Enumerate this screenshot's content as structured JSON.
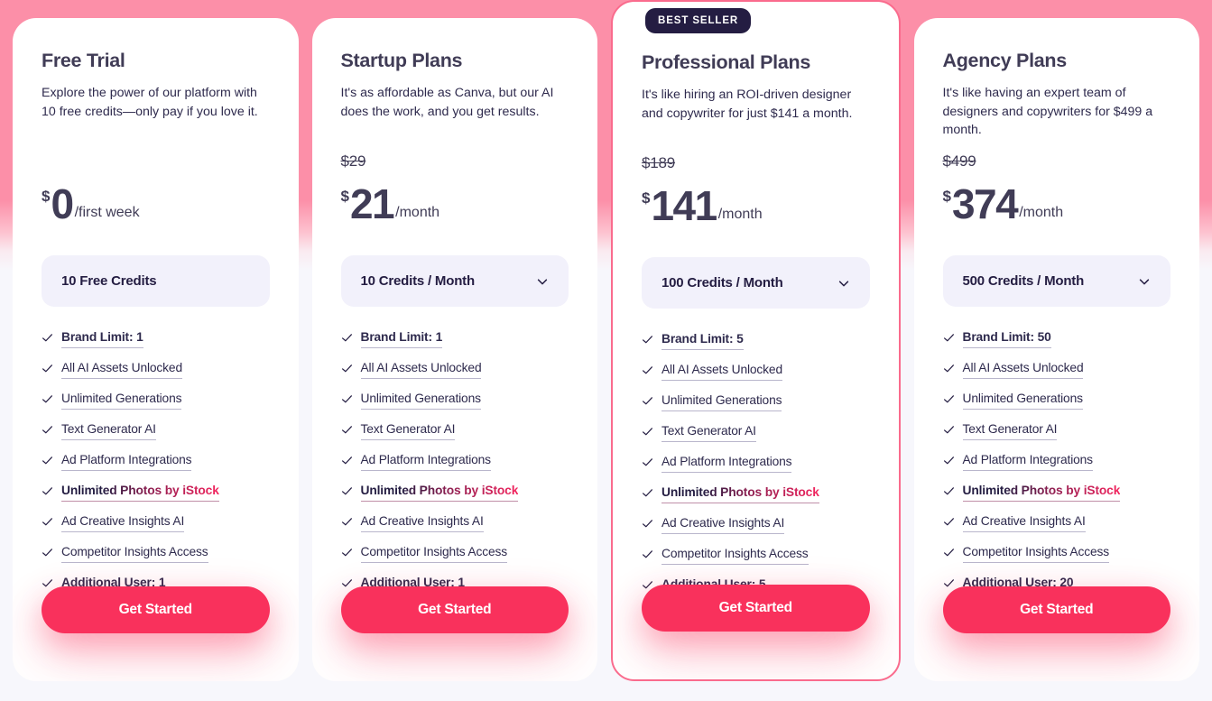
{
  "page": {
    "background_top_color": "#fc8fa8",
    "background_bottom_color": "#f7f7fc",
    "accent_color": "#f9315c",
    "badge_color": "#241d42"
  },
  "badge": {
    "label": "BEST SELLER"
  },
  "icons": {
    "check": "check-icon",
    "chevron": "chevron-down-icon"
  },
  "plans": [
    {
      "id": "free-trial",
      "title": "Free Trial",
      "description": "Explore the power of our platform with 10 free credits—only pay if you love it.",
      "old_price": "",
      "currency": "$",
      "amount": "0",
      "period": "/first week",
      "credits_label": "10 Free Credits",
      "has_dropdown": false,
      "featured": false,
      "cta_label": "Get Started",
      "features": [
        {
          "text": "Brand Limit: 1",
          "style": "bold"
        },
        {
          "text": "All AI Assets Unlocked",
          "style": "normal"
        },
        {
          "text": "Unlimited Generations",
          "style": "normal"
        },
        {
          "text": "Text Generator AI",
          "style": "normal"
        },
        {
          "text": "Ad Platform Integrations",
          "style": "normal"
        },
        {
          "text": "Unlimited Photos by iStock",
          "style": "gradient"
        },
        {
          "text": "Ad Creative Insights AI",
          "style": "normal"
        },
        {
          "text": "Competitor Insights Access",
          "style": "normal"
        },
        {
          "text": "Additional User: 1",
          "style": "bold"
        }
      ]
    },
    {
      "id": "startup-plans",
      "title": "Startup Plans",
      "description": "It's as affordable as Canva, but our AI does the work, and you get results.",
      "old_price": "$29",
      "currency": "$",
      "amount": "21",
      "period": "/month",
      "credits_label": "10 Credits / Month",
      "has_dropdown": true,
      "featured": false,
      "cta_label": "Get Started",
      "features": [
        {
          "text": "Brand Limit: 1",
          "style": "bold"
        },
        {
          "text": "All AI Assets Unlocked",
          "style": "normal"
        },
        {
          "text": "Unlimited Generations",
          "style": "normal"
        },
        {
          "text": "Text Generator AI",
          "style": "normal"
        },
        {
          "text": "Ad Platform Integrations",
          "style": "normal"
        },
        {
          "text": "Unlimited Photos by iStock",
          "style": "gradient"
        },
        {
          "text": "Ad Creative Insights AI",
          "style": "normal"
        },
        {
          "text": "Competitor Insights Access",
          "style": "normal"
        },
        {
          "text": "Additional User: 1",
          "style": "bold"
        }
      ]
    },
    {
      "id": "professional-plans",
      "title": "Professional Plans",
      "description": "It's like hiring an ROI-driven designer and copywriter for just $141 a month.",
      "old_price": "$189",
      "currency": "$",
      "amount": "141",
      "period": "/month",
      "credits_label": "100 Credits / Month",
      "has_dropdown": true,
      "featured": true,
      "cta_label": "Get Started",
      "features": [
        {
          "text": "Brand Limit: 5",
          "style": "bold"
        },
        {
          "text": "All AI Assets Unlocked",
          "style": "normal"
        },
        {
          "text": "Unlimited Generations",
          "style": "normal"
        },
        {
          "text": "Text Generator AI",
          "style": "normal"
        },
        {
          "text": "Ad Platform Integrations",
          "style": "normal"
        },
        {
          "text": "Unlimited Photos by iStock",
          "style": "gradient"
        },
        {
          "text": "Ad Creative Insights AI",
          "style": "normal"
        },
        {
          "text": "Competitor Insights Access",
          "style": "normal"
        },
        {
          "text": "Additional User: 5",
          "style": "bold"
        }
      ]
    },
    {
      "id": "agency-plans",
      "title": "Agency Plans",
      "description": "It's like having an expert team of designers and copywriters for $499 a month.",
      "old_price": "$499",
      "currency": "$",
      "amount": "374",
      "period": "/month",
      "credits_label": "500 Credits / Month",
      "has_dropdown": true,
      "featured": false,
      "cta_label": "Get Started",
      "features": [
        {
          "text": "Brand Limit: 50",
          "style": "bold"
        },
        {
          "text": "All AI Assets Unlocked",
          "style": "normal"
        },
        {
          "text": "Unlimited Generations",
          "style": "normal"
        },
        {
          "text": "Text Generator AI",
          "style": "normal"
        },
        {
          "text": "Ad Platform Integrations",
          "style": "normal"
        },
        {
          "text": "Unlimited Photos by iStock",
          "style": "gradient"
        },
        {
          "text": "Ad Creative Insights AI",
          "style": "normal"
        },
        {
          "text": "Competitor Insights Access",
          "style": "normal"
        },
        {
          "text": "Additional User: 20",
          "style": "bold"
        }
      ]
    }
  ]
}
